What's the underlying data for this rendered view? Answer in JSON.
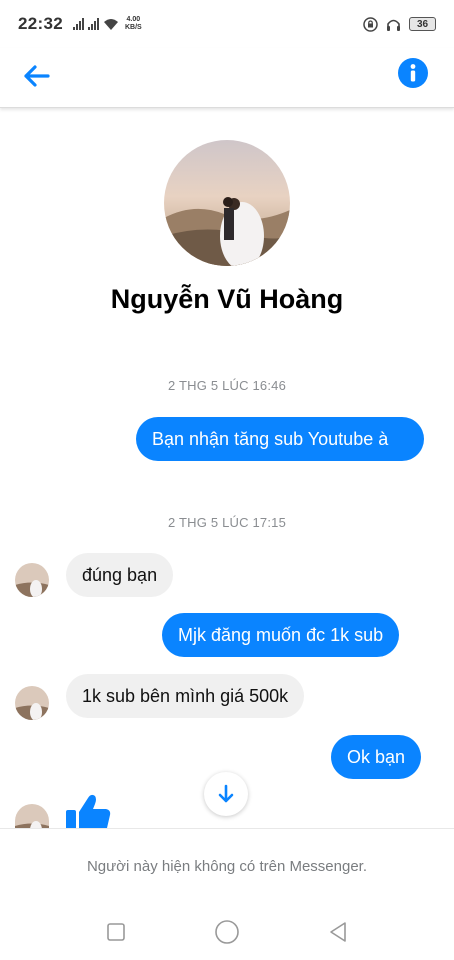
{
  "status_bar": {
    "time": "22:32",
    "net_speed_value": "4.00",
    "net_speed_unit": "KB/S",
    "battery": "36"
  },
  "header": {
    "back_icon": "arrow-left-icon",
    "info_icon": "info-icon",
    "accent_color": "#0a84ff"
  },
  "profile": {
    "name": "Nguyễn Vũ Hoàng"
  },
  "conversation": {
    "timestamps": [
      "2 THG 5 LÚC 16:46",
      "2 THG 5 LÚC 17:15"
    ],
    "messages": [
      {
        "from": "me",
        "text": "Bạn nhận tăng sub Youtube à"
      },
      {
        "from": "them",
        "text": "đúng bạn"
      },
      {
        "from": "me",
        "text": "Mjk đăng muốn đc 1k sub"
      },
      {
        "from": "them",
        "text": "1k sub bên mình giá 500k"
      },
      {
        "from": "me",
        "text": "Ok bạn"
      },
      {
        "from": "them",
        "type": "like",
        "icon": "thumbs-up-icon"
      }
    ],
    "outgoing_color": "#0a84ff",
    "incoming_color": "#f0f0f0"
  },
  "footer": {
    "notice": "Người này hiện không có trên Messenger."
  },
  "nav": {
    "buttons": [
      "recent-apps-icon",
      "home-icon",
      "back-triangle-icon"
    ]
  }
}
